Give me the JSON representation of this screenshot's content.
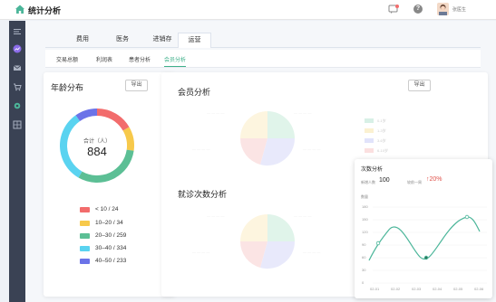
{
  "app": {
    "title": "统计分析",
    "username": "张医生"
  },
  "tabs_primary": [
    {
      "label": "费用",
      "active": false
    },
    {
      "label": "医务",
      "active": false
    },
    {
      "label": "进销存",
      "active": false
    },
    {
      "label": "运营",
      "active": true
    }
  ],
  "tabs_sub": [
    {
      "label": "交易总额",
      "active": false
    },
    {
      "label": "利润表",
      "active": false
    },
    {
      "label": "患者分析",
      "active": false
    },
    {
      "label": "会员分析",
      "active": true
    }
  ],
  "age_card": {
    "title": "年龄分布",
    "export_label": "导出",
    "center_label": "合计（人）",
    "center_value": "884",
    "legend": [
      {
        "label": "< 10 / 24",
        "color": "#f26c6c"
      },
      {
        "label": "10–20 / 34",
        "color": "#f7c94b"
      },
      {
        "label": "20–30 / 259",
        "color": "#5cbf95"
      },
      {
        "label": "30–40 / 334",
        "color": "#5ad3f0"
      },
      {
        "label": "40–50 / 233",
        "color": "#6b73e8"
      }
    ]
  },
  "member_card": {
    "title": "会员分析",
    "export_label": "导出",
    "visits_title": "就诊次数分析",
    "legend_labels": [
      "0-1岁",
      "1-3岁",
      "3-6岁",
      "6-10岁"
    ]
  },
  "visit_card": {
    "title": "次数分析",
    "stat1_label": "新增人数",
    "stat1_value": "100",
    "stat2_label": "较前一周",
    "stat2_value": "20%",
    "y_axis_label": "数量",
    "y_ticks": [
      "180",
      "150",
      "120",
      "90",
      "60",
      "30",
      "0"
    ],
    "x_ticks": [
      "02-01",
      "02-02",
      "02-03",
      "02-04",
      "02-05",
      "02-06"
    ],
    "accent": "#4cb69a"
  }
}
